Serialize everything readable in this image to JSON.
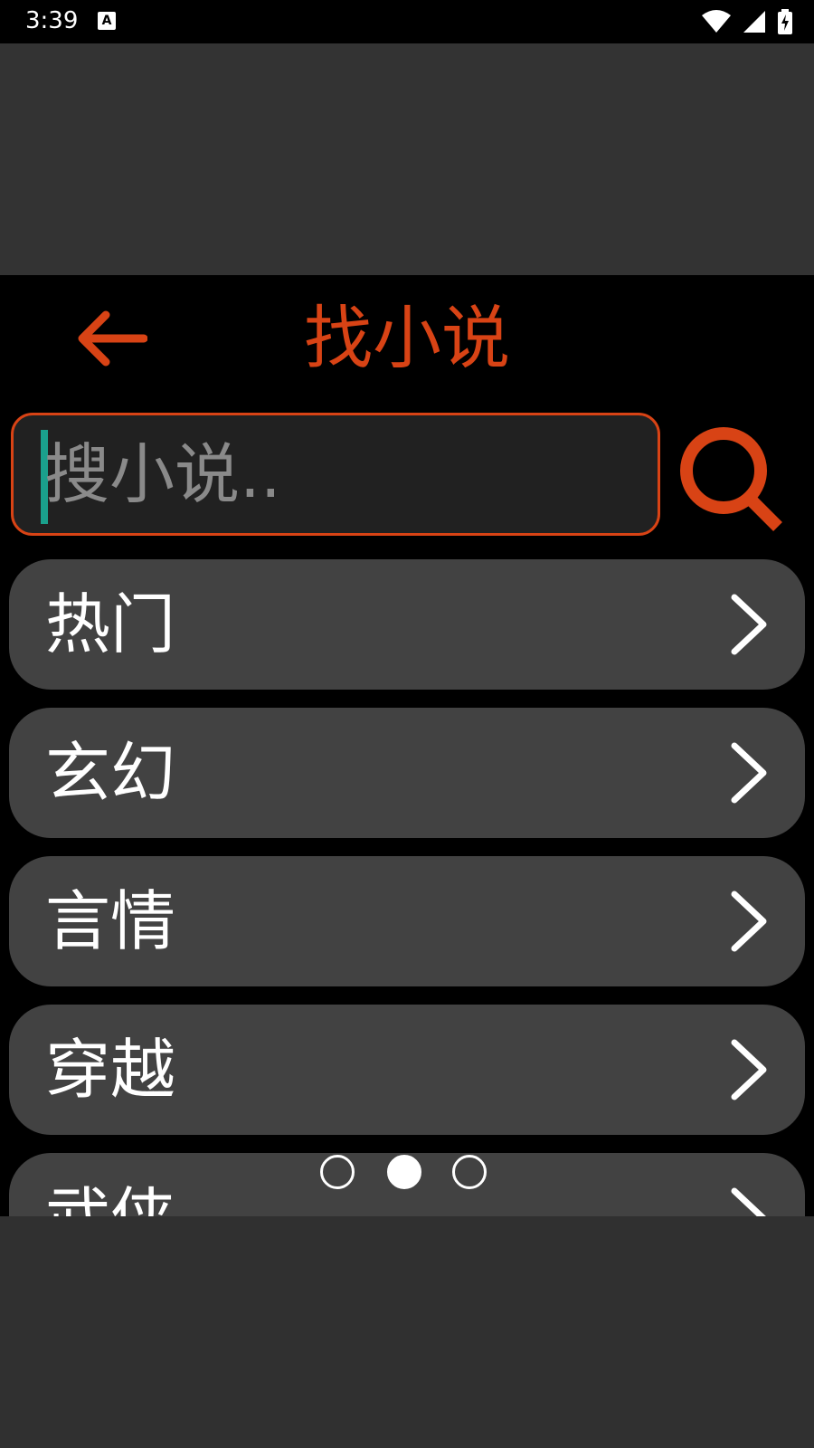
{
  "status_bar": {
    "time": "3:39",
    "notification_icon_letter": "A",
    "icons": [
      "wifi-icon",
      "signal-icon",
      "battery-charging-icon"
    ]
  },
  "header": {
    "title": "找小说",
    "back_icon": "arrow-left-icon"
  },
  "search": {
    "placeholder": "搜小说..",
    "value": "",
    "button_icon": "search-icon"
  },
  "categories": [
    {
      "label": "热门"
    },
    {
      "label": "玄幻"
    },
    {
      "label": "言情"
    },
    {
      "label": "穿越"
    },
    {
      "label": "武侠"
    }
  ],
  "pager": {
    "count": 3,
    "active_index": 1
  },
  "colors": {
    "accent": "#d84315",
    "cursor": "#1aa08c",
    "item_bg": "#424242",
    "screen_bg": "#000000"
  }
}
